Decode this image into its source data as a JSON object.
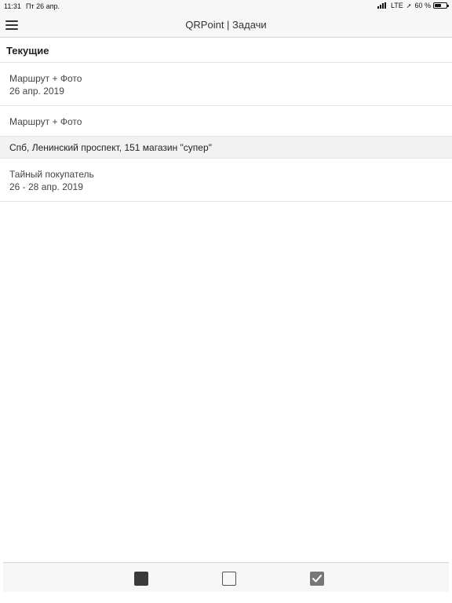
{
  "status_bar": {
    "time": "11:31",
    "date": "Пт 26 апр.",
    "network": "LTE",
    "location_glyph": "➚",
    "battery_percent": "60 %",
    "battery_level": 0.6
  },
  "nav": {
    "title": "QRPoint | Задачи",
    "menu_icon": "hamburger-icon"
  },
  "section": {
    "title": "Текущие"
  },
  "tasks": [
    {
      "title": "Маршрут + Фото",
      "date": "26 апр. 2019"
    },
    {
      "title": "Маршрут + Фото",
      "date": ""
    }
  ],
  "group": {
    "title": "Спб, Ленинский проспект, 151 магазин \"супер\"",
    "tasks": [
      {
        "title": "Тайный покупатель",
        "date": "26 - 28 апр. 2019"
      }
    ]
  },
  "tab_bar": {
    "tabs": [
      {
        "icon": "filled-square-icon"
      },
      {
        "icon": "empty-square-icon"
      },
      {
        "icon": "checked-square-icon"
      }
    ]
  },
  "colors": {
    "bar_background": "#f7f7f7",
    "group_background": "#f2f2f2",
    "divider": "#e3e3e3"
  }
}
